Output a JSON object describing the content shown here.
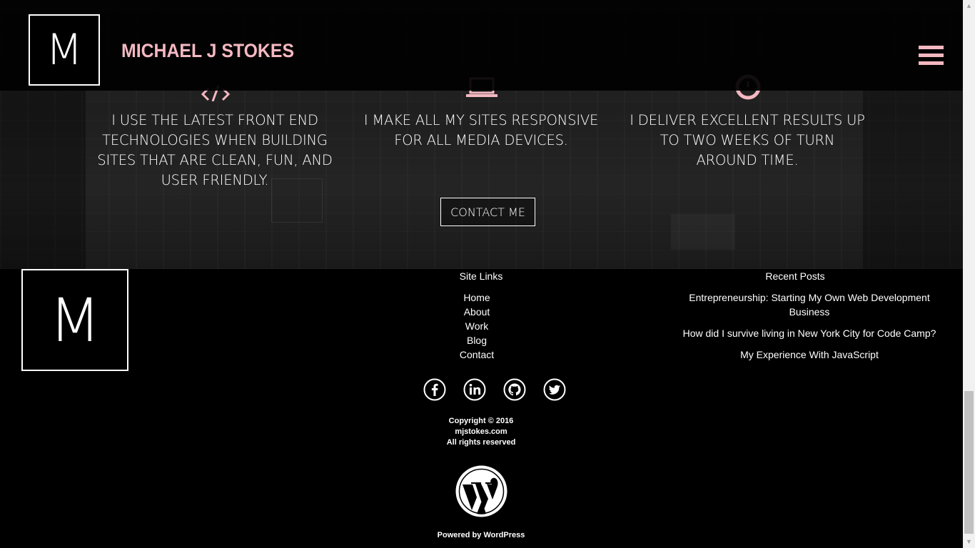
{
  "header": {
    "logo_letter": "M",
    "site_title": "MICHAEL J STOKES",
    "menu_icon": "hamburger-menu-icon"
  },
  "features": [
    {
      "icon": "code-icon",
      "text": "I USE THE LATEST FRONT END TECHNOLOGIES WHEN BUILDING SITES THAT ARE CLEAN, FUN, AND USER FRIENDLY."
    },
    {
      "icon": "laptop-icon",
      "text": "I MAKE ALL MY SITES RESPONSIVE FOR ALL MEDIA DEVICES."
    },
    {
      "icon": "clock-icon",
      "text": "I DELIVER EXCELLENT RESULTS UP TO TWO WEEKS OF TURN AROUND TIME."
    }
  ],
  "contact_button": "CONTACT ME",
  "footer": {
    "logo_letter": "M",
    "site_links_title": "Site Links",
    "site_links": [
      "Home",
      "About",
      "Work",
      "Blog",
      "Contact"
    ],
    "recent_posts_title": "Recent Posts",
    "recent_posts": [
      "Entrepreneurship: Starting My Own Web Development Business",
      "How did I survive living in New York City for Code Camp?",
      "My Experience With JavaScript"
    ],
    "social": [
      "facebook-icon",
      "linkedin-icon",
      "github-icon",
      "twitter-icon"
    ],
    "copyright_line1": "Copyright © 2016",
    "copyright_line2": "mjstokes.com",
    "copyright_line3": "All rights reserved",
    "powered_by": "Powered by WordPress"
  },
  "colors": {
    "accent": "#f4b8c1",
    "background": "#000000",
    "text": "#ffffff"
  }
}
